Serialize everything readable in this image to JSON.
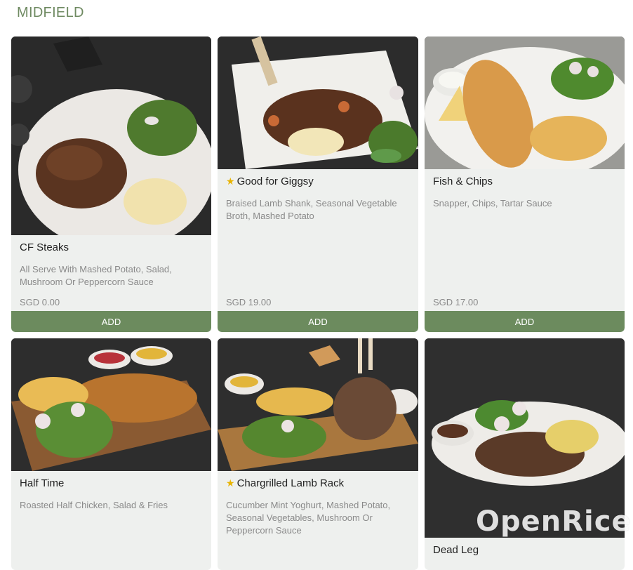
{
  "section": {
    "title": "MIDFIELD"
  },
  "items": [
    {
      "name": "CF Steaks",
      "starred": false,
      "description": "All Serve With Mashed Potato, Salad, Mushroom Or Peppercorn Sauce",
      "price": "SGD 0.00",
      "add_label": "ADD"
    },
    {
      "name": "Good for Giggsy",
      "starred": true,
      "description": "Braised Lamb Shank, Seasonal Vegetable Broth, Mashed Potato",
      "price": "SGD 19.00",
      "add_label": "ADD"
    },
    {
      "name": "Fish & Chips",
      "starred": false,
      "description": "Snapper, Chips, Tartar Sauce",
      "price": "SGD 17.00",
      "add_label": "ADD"
    },
    {
      "name": "Half Time",
      "starred": false,
      "description": "Roasted Half Chicken, Salad & Fries"
    },
    {
      "name": "Chargrilled Lamb Rack",
      "starred": true,
      "description": "Cucumber Mint Yoghurt, Mashed Potato, Seasonal Vegetables, Mushroom Or Peppercorn Sauce"
    },
    {
      "name": "Dead Leg",
      "starred": false
    }
  ],
  "icons": {
    "star": "star-icon"
  },
  "colors": {
    "accent": "#6c8b5e",
    "title": "#6f8a62",
    "card_bg": "#eef0ee",
    "star": "#e8b400"
  },
  "watermark": {
    "text": "OpenRice"
  }
}
